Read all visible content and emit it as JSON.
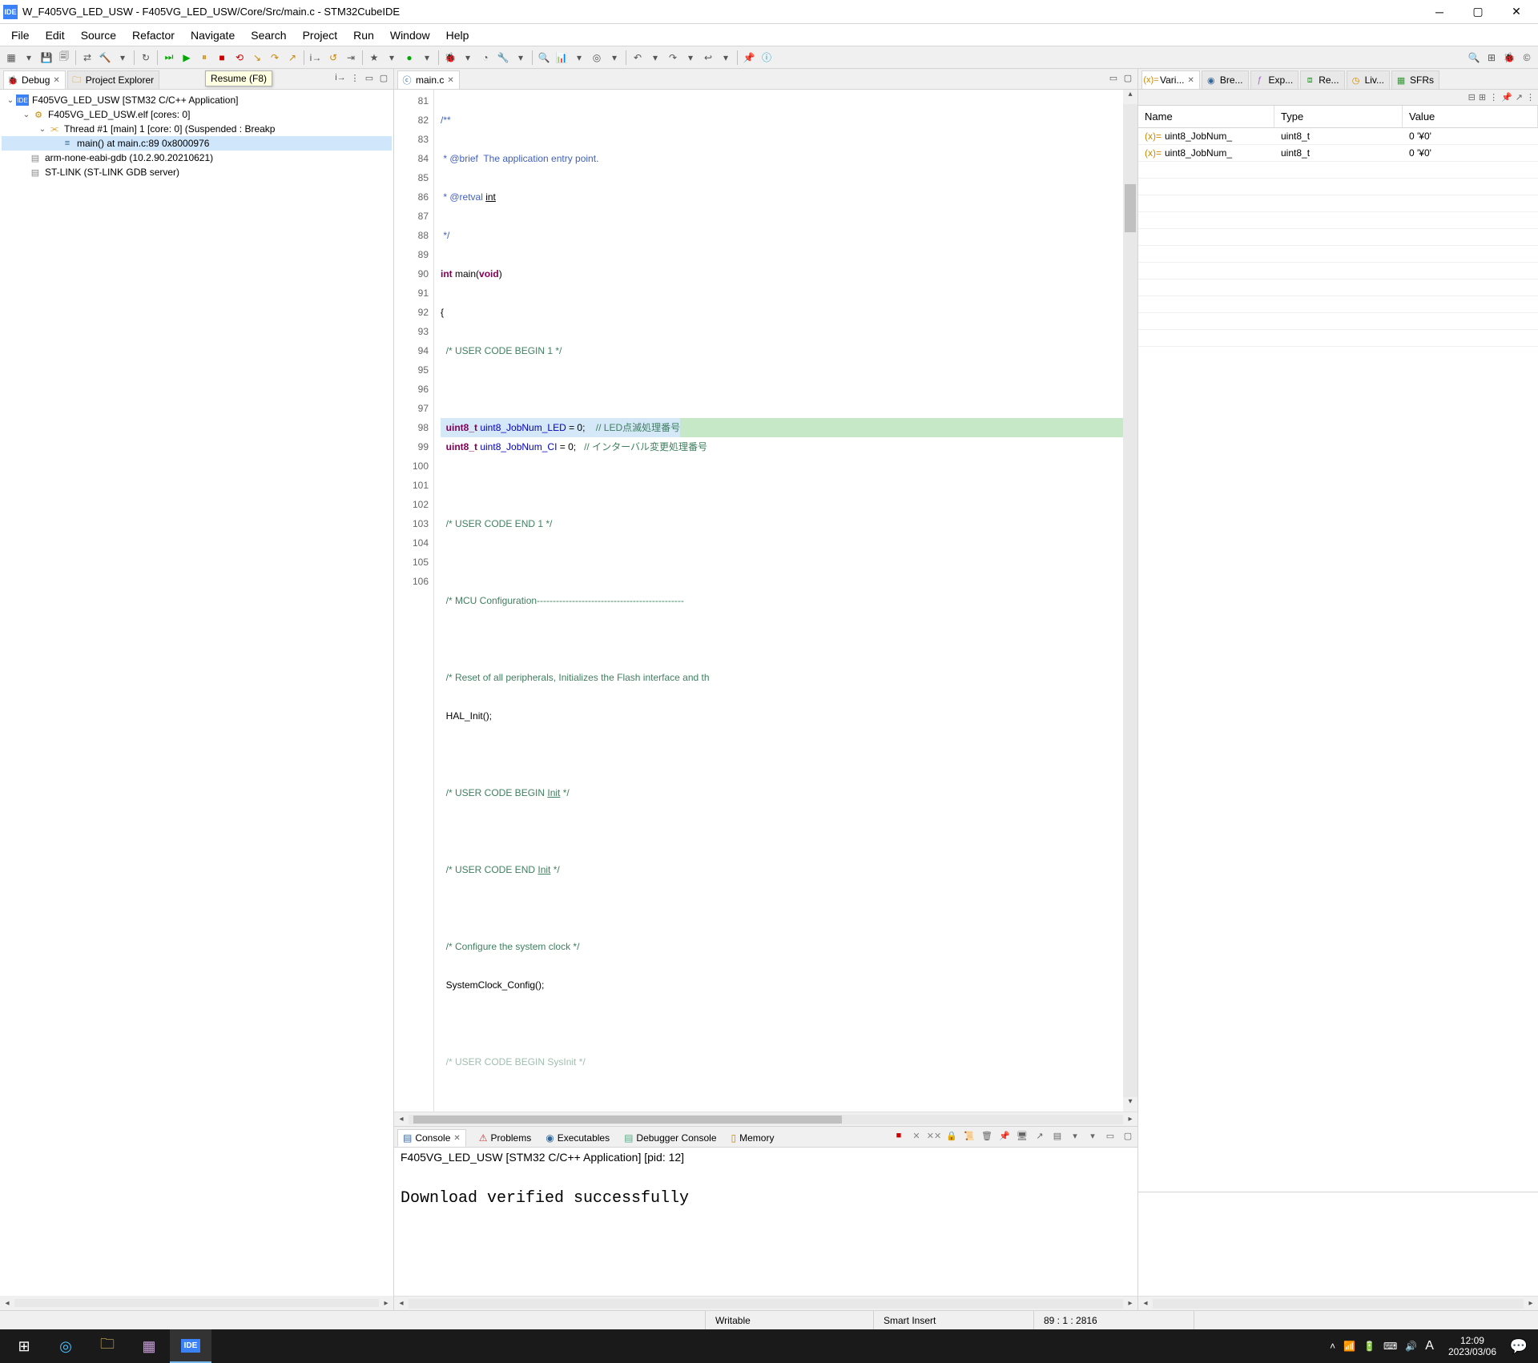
{
  "window": {
    "title": "W_F405VG_LED_USW - F405VG_LED_USW/Core/Src/main.c - STM32CubeIDE"
  },
  "menu": [
    "File",
    "Edit",
    "Source",
    "Refactor",
    "Navigate",
    "Search",
    "Project",
    "Run",
    "Window",
    "Help"
  ],
  "tooltip": "Resume (F8)",
  "left_tabs": {
    "debug": "Debug",
    "project_explorer": "Project Explorer"
  },
  "debug_tree": {
    "root": "F405VG_LED_USW [STM32 C/C++ Application]",
    "elf": "F405VG_LED_USW.elf [cores: 0]",
    "thread": "Thread #1 [main] 1 [core: 0] (Suspended : Breakp",
    "frame": "main() at main.c:89 0x8000976",
    "gdb": "arm-none-eabi-gdb (10.2.90.20210621)",
    "stlink": "ST-LINK (ST-LINK GDB server)"
  },
  "editor_tab": "main.c",
  "code_lines": [
    {
      "n": "81",
      "fold": "⊟"
    },
    {
      "n": "82"
    },
    {
      "n": "83"
    },
    {
      "n": "84"
    },
    {
      "n": "85",
      "fold": "⊟"
    },
    {
      "n": "86"
    },
    {
      "n": "87"
    },
    {
      "n": "88"
    },
    {
      "n": "89"
    },
    {
      "n": "90"
    },
    {
      "n": "91"
    },
    {
      "n": "92"
    },
    {
      "n": "93"
    },
    {
      "n": "94"
    },
    {
      "n": "95"
    },
    {
      "n": "96"
    },
    {
      "n": "97"
    },
    {
      "n": "98"
    },
    {
      "n": "99"
    },
    {
      "n": "100"
    },
    {
      "n": "101"
    },
    {
      "n": "102"
    },
    {
      "n": "103"
    },
    {
      "n": "104"
    },
    {
      "n": "105"
    },
    {
      "n": "106"
    }
  ],
  "code": {
    "l81": "/**",
    "l82": " * @brief  The application entry point.",
    "l83a": " * @retval ",
    "l83b": "int",
    "l84": " */",
    "l85a": "int",
    "l85b": " main(",
    "l85c": "void",
    "l85d": ")",
    "l86": "{",
    "l87": "  /* USER CODE BEGIN 1 */",
    "l88": "",
    "l89a": "  uint8_t ",
    "l89b": "uint8_JobNum_LED",
    "l89c": " = 0;    ",
    "l89d": "// LED点滅処理番号",
    "l90a": "  uint8_t ",
    "l90b": "uint8_JobNum_CI",
    "l90c": " = 0;   ",
    "l90d": "// インターバル変更処理番号",
    "l91": "",
    "l92": "  /* USER CODE END 1 */",
    "l93": "",
    "l94": "  /* MCU Configuration----------------------------------------------",
    "l95": "",
    "l96": "  /* Reset of all peripherals, Initializes the Flash interface and th",
    "l97": "  HAL_Init();",
    "l98": "",
    "l99a": "  /* USER CODE BEGIN ",
    "l99b": "Init",
    "l99c": " */",
    "l100": "",
    "l101a": "  /* USER CODE END ",
    "l101b": "Init",
    "l101c": " */",
    "l102": "",
    "l103": "  /* Configure the system clock */",
    "l104": "  SystemClock_Config();",
    "l105": "",
    "l106": "  /* USER CODE BEGIN SysInit */"
  },
  "right_tabs": [
    "Vari...",
    "Bre...",
    "Exp...",
    "Re...",
    "Liv...",
    "SFRs"
  ],
  "vars_header": {
    "name": "Name",
    "type": "Type",
    "value": "Value"
  },
  "vars_rows": [
    {
      "name": "uint8_JobNum_",
      "type": "uint8_t",
      "value": "0 '¥0'"
    },
    {
      "name": "uint8_JobNum_",
      "type": "uint8_t",
      "value": "0 '¥0'"
    }
  ],
  "console_tabs": [
    "Console",
    "Problems",
    "Executables",
    "Debugger Console",
    "Memory"
  ],
  "console_desc": "F405VG_LED_USW [STM32 C/C++ Application]  [pid: 12]",
  "console_text": "Download verified successfully",
  "status": {
    "writable": "Writable",
    "insert": "Smart Insert",
    "pos": "89 : 1 : 2816"
  },
  "taskbar": {
    "time": "12:09",
    "date": "2023/03/06",
    "input": "A"
  }
}
